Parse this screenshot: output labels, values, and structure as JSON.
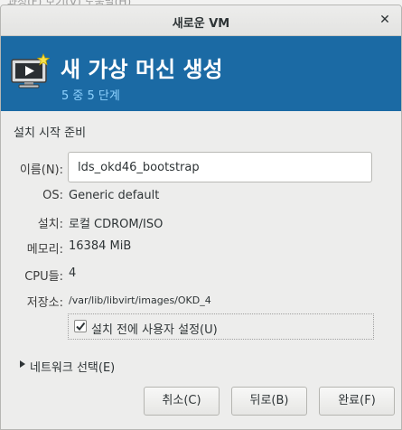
{
  "background_menubar": "과정(F)   보기(V)   도움말(H)",
  "window": {
    "title": "새로운 VM",
    "close_glyph": "✕"
  },
  "banner": {
    "title": "새 가상 머신 생성",
    "subtitle": "5 중 5 단계",
    "icon": "vm-monitor-star-icon",
    "color": "#1b6aa4",
    "subtitle_color": "#8fd3ff"
  },
  "section_title": "설치 시작 준비",
  "fields": {
    "name_label": "이름(N):",
    "name_value": "lds_okd46_bootstrap",
    "os_label": "OS:",
    "os_value": "Generic default",
    "install_label": "설치:",
    "install_value": "로컬 CDROM/ISO",
    "memory_label": "메모리:",
    "memory_value": "16384 MiB",
    "cpu_label": "CPU들:",
    "cpu_value": "4",
    "storage_label": "저장소:",
    "storage_value": "/var/lib/libvirt/images/OKD_4"
  },
  "customize": {
    "label": "설치 전에 사용자 설정(U)",
    "checked": true
  },
  "network_expander": {
    "label": "네트워크 선택(E)",
    "expanded": false
  },
  "buttons": {
    "cancel": "취소(C)",
    "back": "뒤로(B)",
    "finish": "완료(F)"
  }
}
